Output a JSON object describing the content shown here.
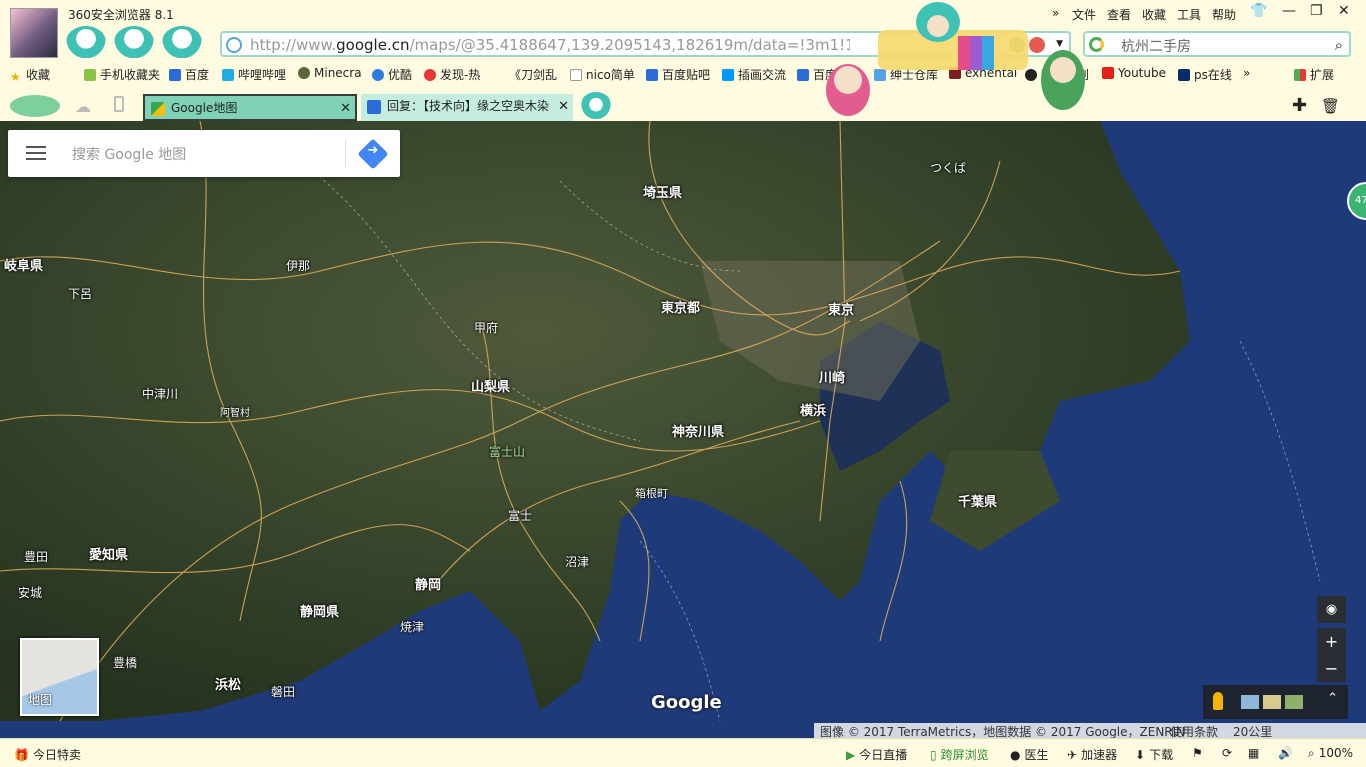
{
  "window": {
    "title": "360安全浏览器 8.1"
  },
  "menubar": {
    "items": [
      "文件",
      "查看",
      "收藏",
      "工具",
      "帮助"
    ],
    "more": "»"
  },
  "address": {
    "url_prefix": "http://www.",
    "url_domain": "google.cn",
    "url_rest": "/maps/@35.4188647,139.2095143,182619m/data=!3m1!1e3"
  },
  "search": {
    "placeholder": "杭州二手房"
  },
  "bookmarks": {
    "favorites": "收藏",
    "items": [
      "手机收藏夹",
      "百度",
      "哔哩哔哩",
      "Minecra",
      "优酷",
      "发现-热",
      "《刀剑乱",
      "nico简单",
      "百度贴吧",
      "插画交流",
      "百度翻译",
      "绅士仓库",
      "exhentai",
      "欢迎来到",
      "Youtube",
      "ps在线"
    ],
    "more": "»",
    "extensions": "扩展"
  },
  "tabs": [
    {
      "label": "Google地图",
      "active": true
    },
    {
      "label": "回复：【技术向】缘之空奥木染",
      "active": false
    }
  ],
  "map": {
    "search_placeholder": "搜索 Google 地图",
    "thumbnail_label": "地图",
    "logo": "Google",
    "places": {
      "saitama": "埼玉県",
      "tsukuba": "つくば",
      "gifu": "岐阜県",
      "ina": "伊那",
      "shimoro": "下呂",
      "tokyo_to": "東京都",
      "tokyo": "東京",
      "kofu": "甲府",
      "yamanashi": "山梨県",
      "kawasaki": "川崎",
      "nakatsugawa": "中津川",
      "achi": "阿智村",
      "yokohama": "横浜",
      "kanagawa": "神奈川県",
      "fuji_san": "富士山",
      "hakone": "箱根町",
      "chiba": "千葉県",
      "fuji": "富士",
      "toyota": "豊田",
      "aichi": "愛知県",
      "numazu": "沼津",
      "anjo": "安城",
      "shizuoka": "静岡",
      "shizuoka_ken": "静岡県",
      "yaizu": "焼津",
      "toyohashi": "豊橋",
      "hamamatsu": "浜松",
      "iwata": "磐田"
    },
    "attribution": "图像 © 2017 TerraMetrics，地图数据 © 2017 Google，ZENRIN",
    "terms": "使用条款",
    "scale": "20公里",
    "badge": "47"
  },
  "status": {
    "deals": "今日特卖",
    "live": "今日直播",
    "cross_screen": "跨屏浏览",
    "doctor": "医生",
    "accelerator": "加速器",
    "download": "下载",
    "zoom": "100%"
  },
  "colors": {
    "chrome_bg": "#fffbe0",
    "tab_active": "#7fd1b8",
    "tab_inactive": "#c4ecdf",
    "road": "#e6b25c",
    "sea": "#243a6e"
  }
}
